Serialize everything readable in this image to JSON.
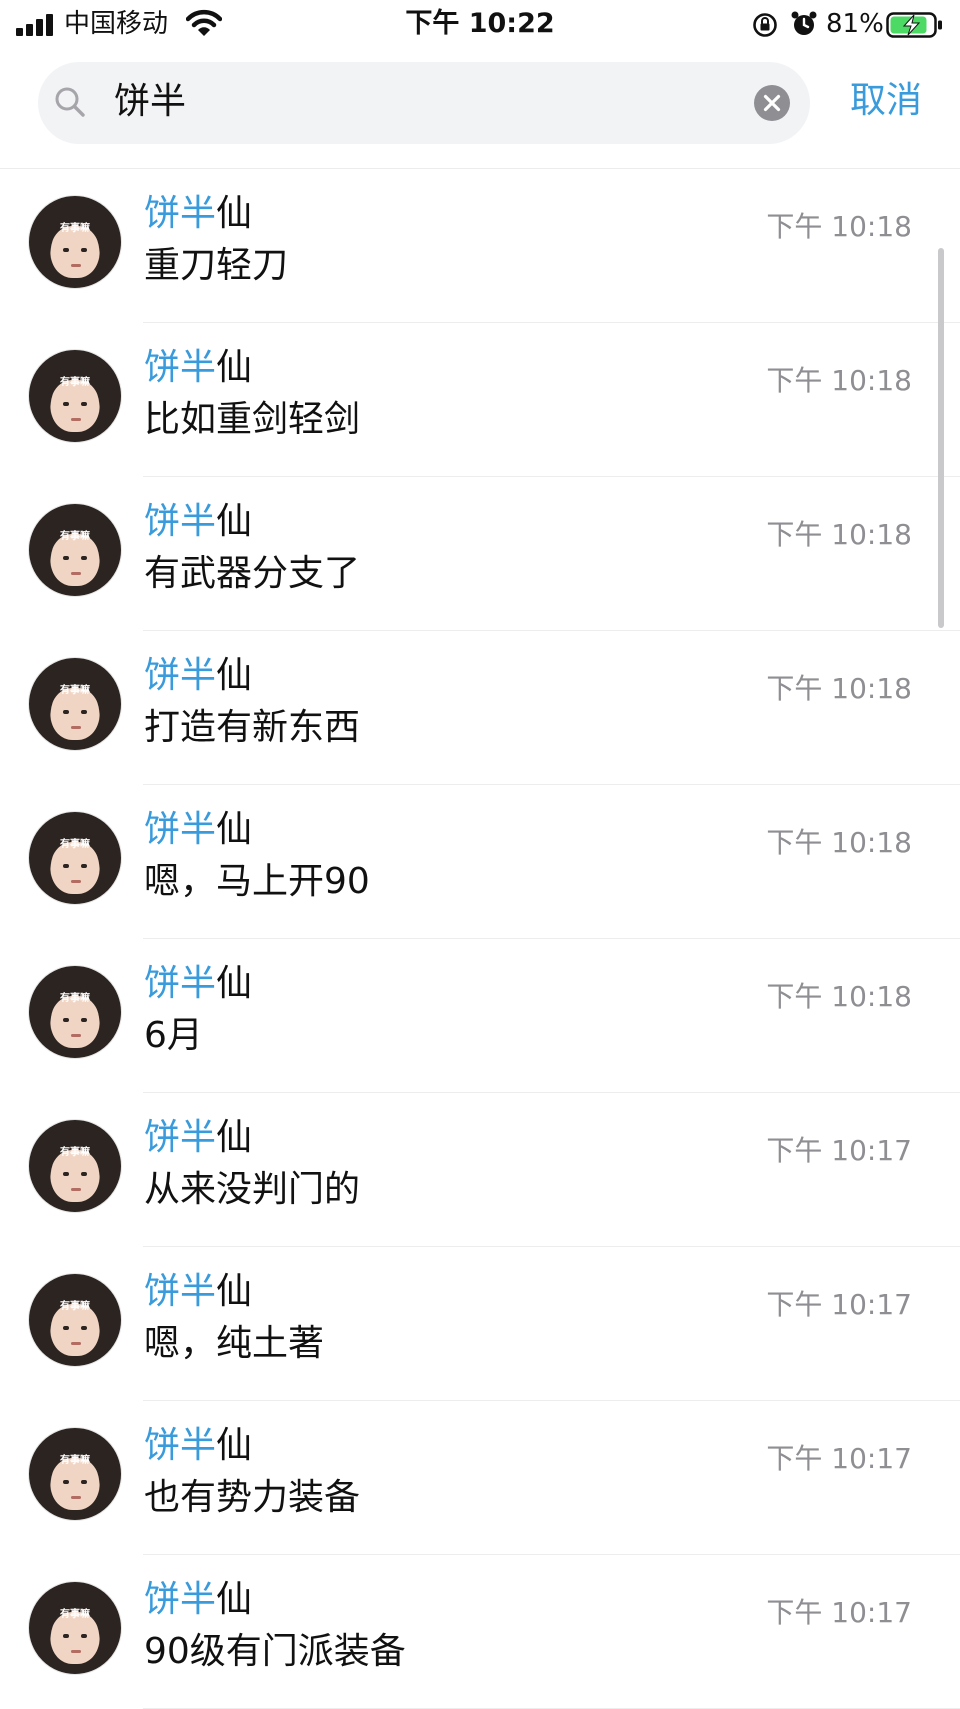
{
  "status_bar": {
    "carrier": "中国移动",
    "time": "下午 10:22",
    "battery_percent": "81%"
  },
  "search": {
    "query": "饼半",
    "cancel_label": "取消"
  },
  "results": [
    {
      "sender_match": "饼半",
      "sender_rest": "仙",
      "time": "下午 10:18",
      "message": "重刀轻刀",
      "avatar_text": "有事嘛"
    },
    {
      "sender_match": "饼半",
      "sender_rest": "仙",
      "time": "下午 10:18",
      "message": "比如重剑轻剑",
      "avatar_text": "有事嘛"
    },
    {
      "sender_match": "饼半",
      "sender_rest": "仙",
      "time": "下午 10:18",
      "message": "有武器分支了",
      "avatar_text": "有事嘛"
    },
    {
      "sender_match": "饼半",
      "sender_rest": "仙",
      "time": "下午 10:18",
      "message": "打造有新东西",
      "avatar_text": "有事嘛"
    },
    {
      "sender_match": "饼半",
      "sender_rest": "仙",
      "time": "下午 10:18",
      "message": "嗯，马上开90",
      "avatar_text": "有事嘛"
    },
    {
      "sender_match": "饼半",
      "sender_rest": "仙",
      "time": "下午 10:18",
      "message": "6月",
      "avatar_text": "有事嘛"
    },
    {
      "sender_match": "饼半",
      "sender_rest": "仙",
      "time": "下午 10:17",
      "message": "从来没判门的",
      "avatar_text": "有事嘛"
    },
    {
      "sender_match": "饼半",
      "sender_rest": "仙",
      "time": "下午 10:17",
      "message": "嗯，纯土著",
      "avatar_text": "有事嘛"
    },
    {
      "sender_match": "饼半",
      "sender_rest": "仙",
      "time": "下午 10:17",
      "message": "也有势力装备",
      "avatar_text": "有事嘛"
    },
    {
      "sender_match": "饼半",
      "sender_rest": "仙",
      "time": "下午 10:17",
      "message": "90级有门派装备",
      "avatar_text": "有事嘛"
    }
  ],
  "colors": {
    "accent": "#3a9bdc",
    "timestamp": "#8e8e93",
    "search_bg": "#f2f3f5"
  }
}
